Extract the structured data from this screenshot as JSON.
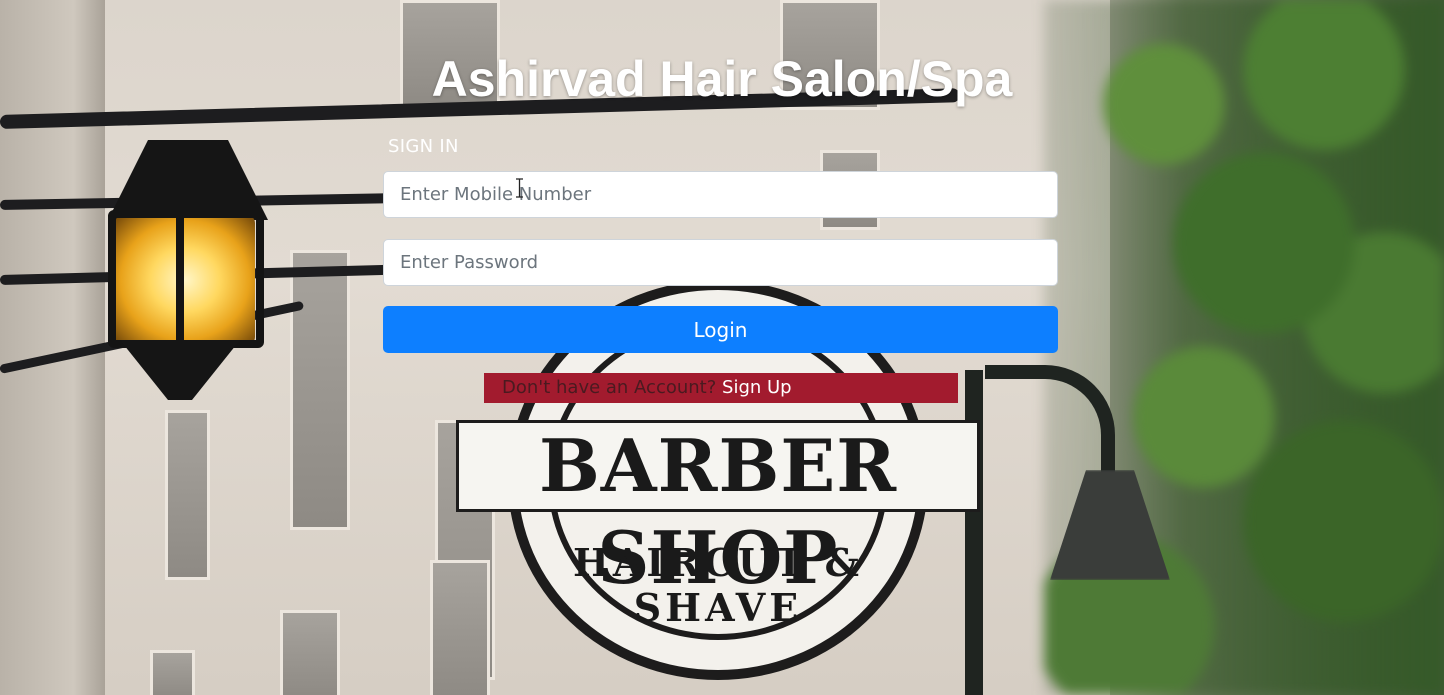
{
  "page": {
    "title": "Ashirvad Hair Salon/Spa",
    "form_heading": "SIGN IN"
  },
  "form": {
    "mobile_placeholder": "Enter Mobile Number",
    "mobile_value": "",
    "password_placeholder": "Enter Password",
    "password_value": "",
    "login_label": "Login"
  },
  "signup": {
    "prompt": "Don't have an Account?",
    "link_label": "Sign Up"
  },
  "background_sign": {
    "main_text": "BARBER SHOP",
    "bottom_text": "HAIRCUT & SHAVE"
  },
  "colors": {
    "primary_button": "#0d7fff",
    "signup_banner": "#a21b2e",
    "title_text": "#ffffff"
  }
}
